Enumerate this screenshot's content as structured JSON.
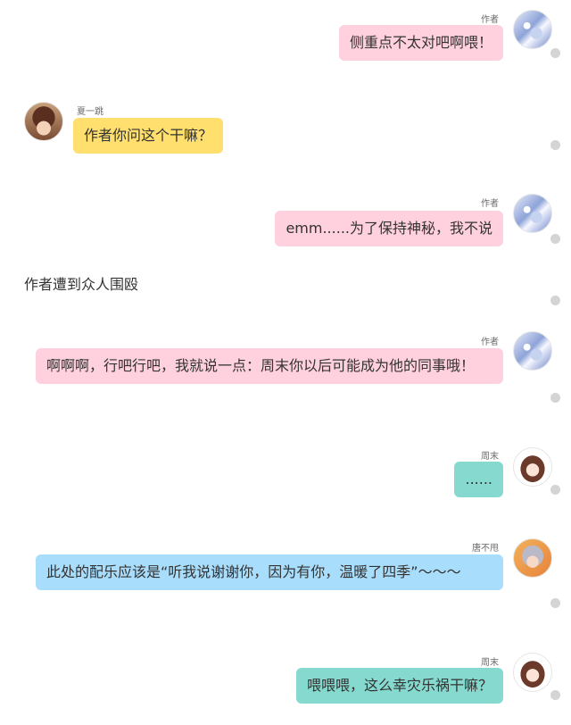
{
  "messages": [
    {
      "name": "作者",
      "text": "侧重点不太对吧啊喂！"
    },
    {
      "name": "夏一跳",
      "text": "作者你问这个干嘛？"
    },
    {
      "name": "作者",
      "text": "emm......为了保持神秘，我不说"
    },
    {
      "name": "作者",
      "text": "啊啊啊，行吧行吧，我就说一点：周末你以后可能成为他的同事哦！"
    },
    {
      "name": "周末",
      "text": "......"
    },
    {
      "name": "唐不甩",
      "text": "此处的配乐应该是“听我说谢谢你，因为有你，温暖了四季”～～～"
    },
    {
      "name": "周末",
      "text": "喂喂喂，这么幸灾乐祸干嘛？"
    }
  ],
  "narration": "作者遭到众人围殴",
  "avatars": {
    "author": "avatar-author",
    "xia": "avatar-xia-yitiao",
    "zhou": "avatar-zhoumo",
    "tang": "avatar-tang-bushuai"
  },
  "colors": {
    "pink": "#ffd0de",
    "yellow": "#ffdf6e",
    "teal": "#86d9ce",
    "blue": "#a9ddfc"
  }
}
